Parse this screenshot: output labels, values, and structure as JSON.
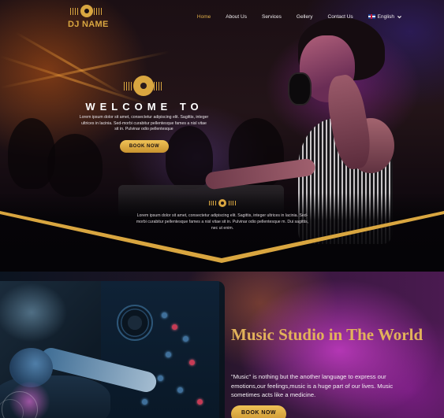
{
  "brand": {
    "name": "DJ NAME",
    "logo_icon": "vinyl-soundwave-icon"
  },
  "nav": {
    "items": [
      {
        "label": "Home",
        "active": true
      },
      {
        "label": "About Us",
        "active": false
      },
      {
        "label": "Services",
        "active": false
      },
      {
        "label": "Gellery",
        "active": false
      },
      {
        "label": "Contact Us",
        "active": false
      }
    ],
    "language": {
      "label": "English",
      "flag_icon": "uk-flag-icon",
      "dropdown_icon": "chevron-down-icon"
    }
  },
  "hero": {
    "heading": "WELCOME TO",
    "paragraph": "Lorem ipsum dolor sit amet, consectetur adipiscing elit. Sagittis, integer ultrices in lacinia. Sed-morbi curabitur pellentesque fames a nisl vitae sit in. Pulvinar odio pellentesque",
    "book_button": "BOOK NOW",
    "paragraph2": "Lorem ipsum dolor sit amet, consectetur adipiscing elit. Sagittis, integer ultrices in lacinia. Sed-morbi curabitur pellentesque fames a nisl vitae sit in. Pulvinar odio pellentesque m. Dui sagittis, nec ut enim."
  },
  "studio": {
    "title": "Music Studio in The World",
    "text": "\"Music\" is nothing but the another language to express our emotions,our feelings,music is a huge part of our lives. Music sometimes acts like a medicine.",
    "book_button": "BOOK NOW"
  },
  "colors": {
    "gold": "#d9a640",
    "gold_light": "#efc257",
    "nav_active": "#e1b04a",
    "dark": "#07060b"
  }
}
